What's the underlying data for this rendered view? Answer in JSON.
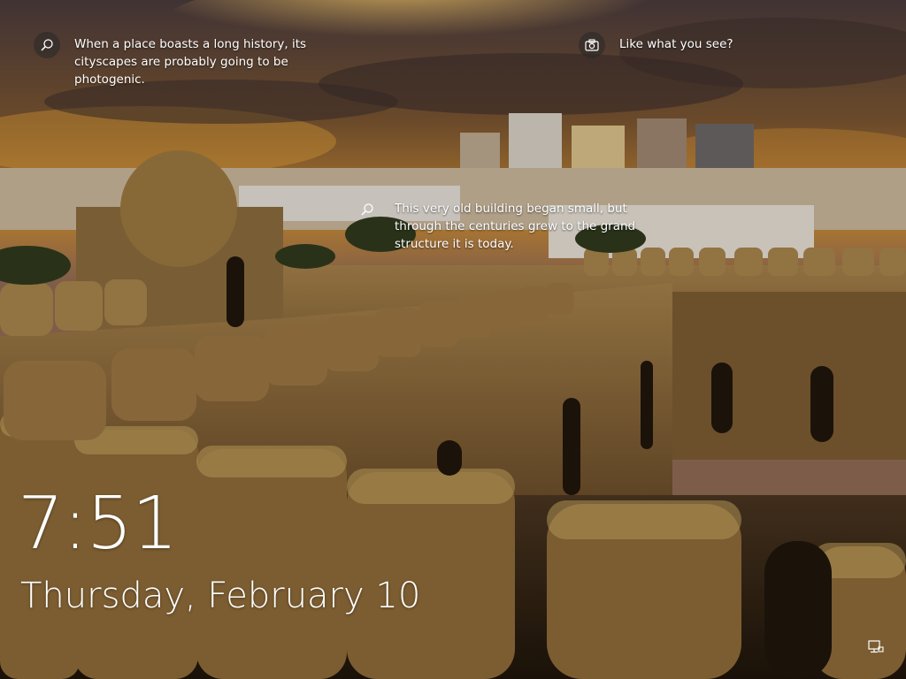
{
  "lockscreen": {
    "spotlight": {
      "history_text": "When a place boasts a long history, its cityscapes are probably going to be photogenic.",
      "history_icon": "search-icon",
      "like_text": "Like what you see?",
      "like_icon": "camera-icon",
      "building_text": "This very old building began small, but through the centuries grew to the grand structure it is today.",
      "building_icon": "search-icon"
    },
    "clock": {
      "time": "7:51",
      "date": "Thursday, February 10"
    },
    "system_tray": {
      "network_icon": "network-icon"
    }
  },
  "colors": {
    "text": "#ffffff",
    "sky_top": "#3a2a2a",
    "sky_glow": "#f2a23a",
    "stone": "#8a6a3a"
  }
}
